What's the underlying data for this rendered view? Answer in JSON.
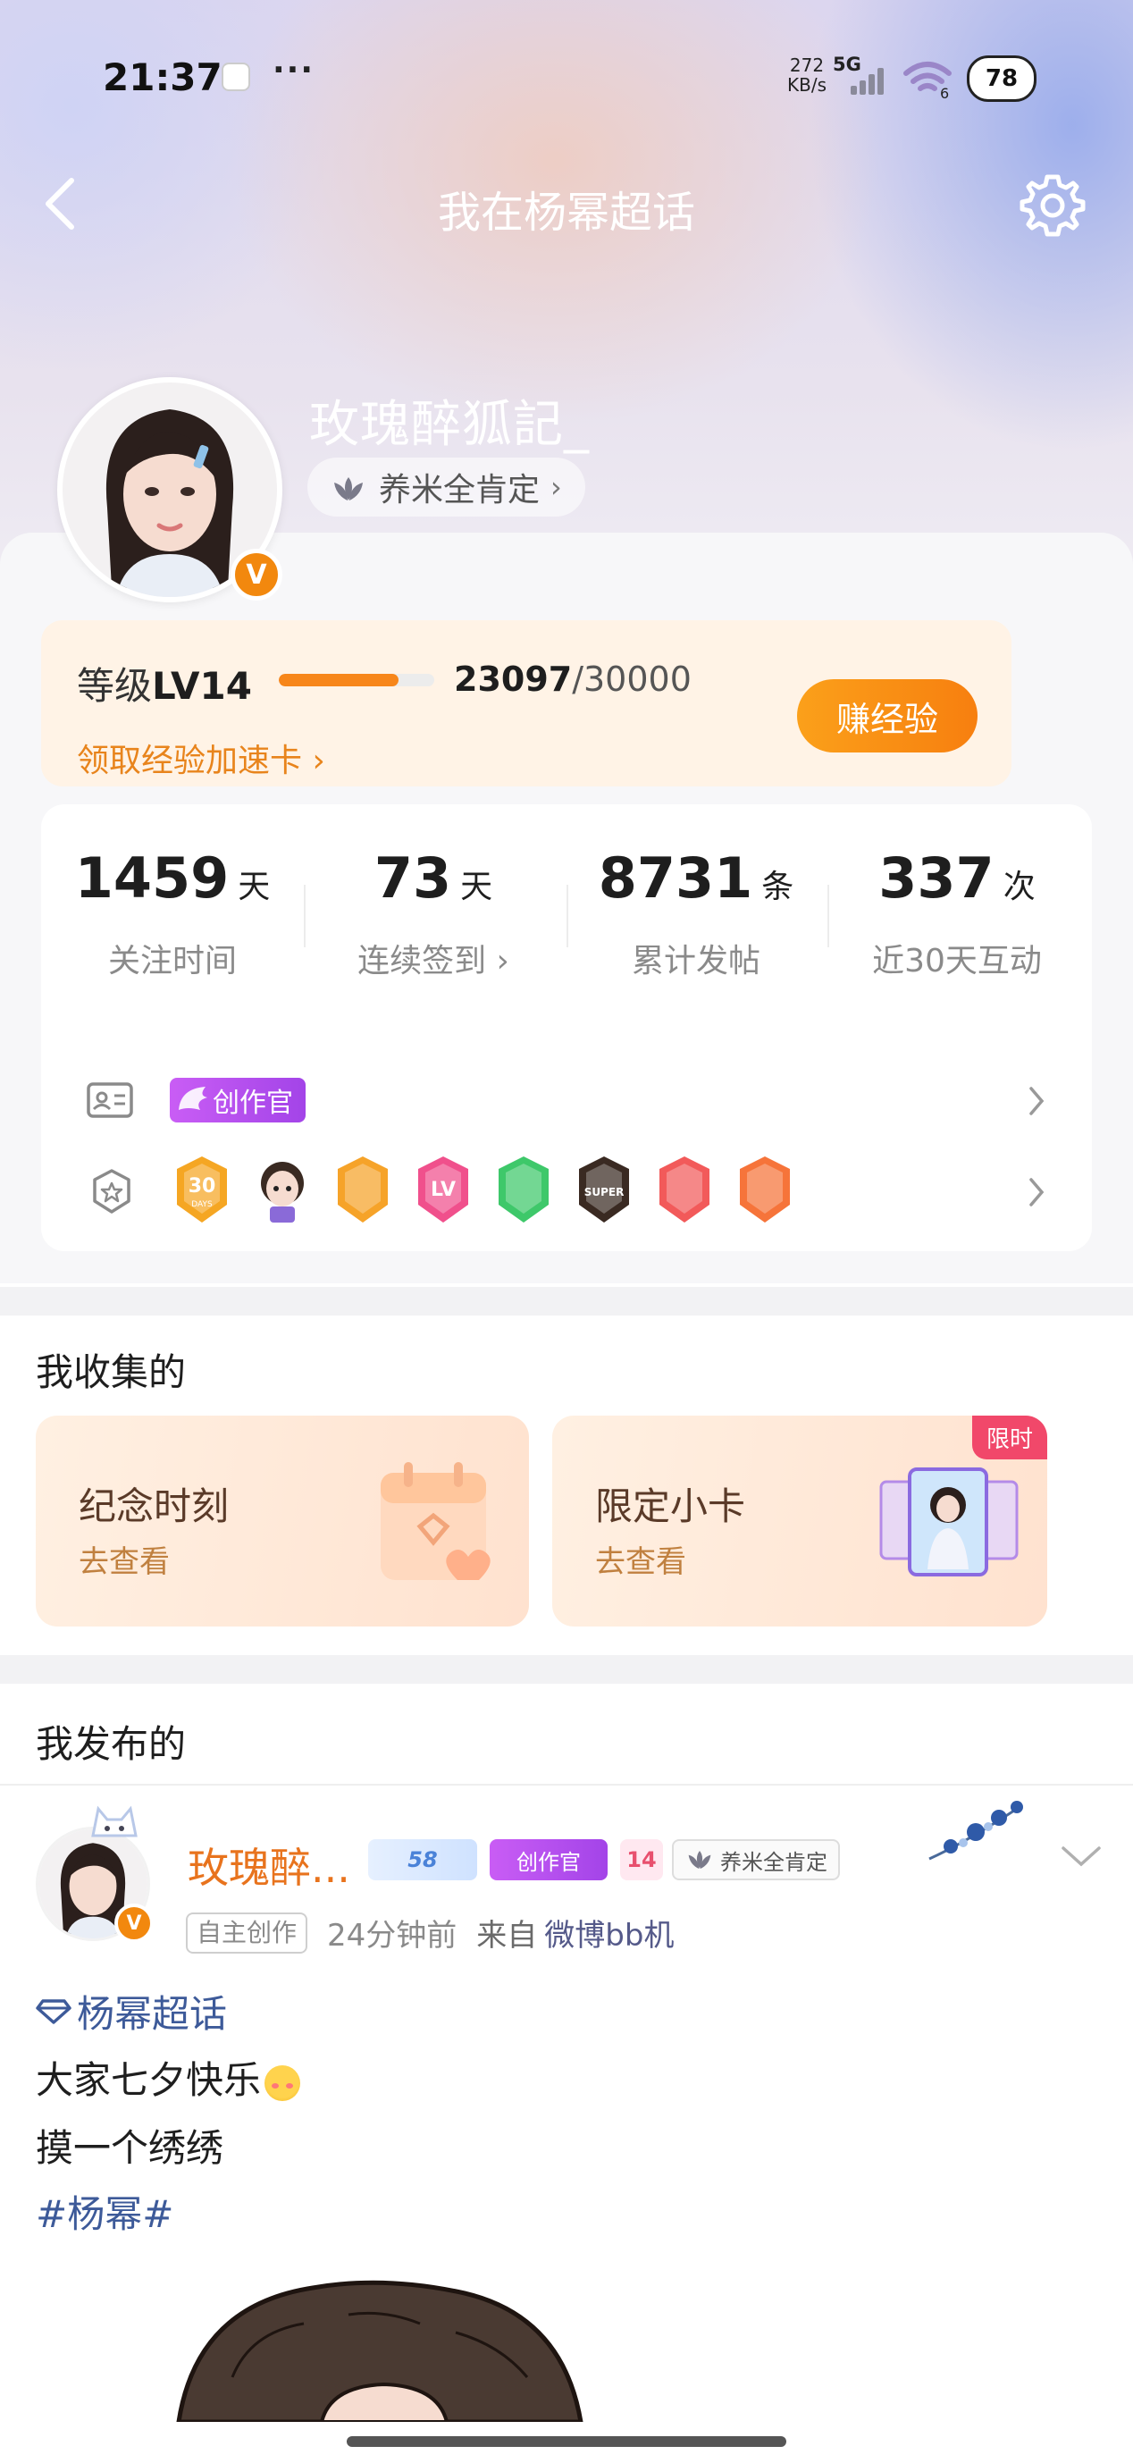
{
  "status_bar": {
    "time": "21:37",
    "more": "···",
    "net_speed_value": "272",
    "net_speed_unit": "KB/s",
    "network": "5G",
    "wifi_badge": "6",
    "battery": "78"
  },
  "nav": {
    "title": "我在杨幂超话",
    "back_icon": "back-chevron-icon",
    "settings_icon": "gear-icon"
  },
  "profile": {
    "username": "玫瑰醉狐記_",
    "verify_badge": "V",
    "honor_label": "养米全肯定",
    "honor_icon": "lotus-icon"
  },
  "level": {
    "label_prefix": "等级",
    "level": "LV14",
    "exp_current": "23097",
    "exp_total": "/30000",
    "progress_fraction": 0.77,
    "boost_link": "领取经验加速卡 ›",
    "earn_button": "赚经验"
  },
  "stats": [
    {
      "value": "1459",
      "unit": "天",
      "label": "关注时间"
    },
    {
      "value": "73",
      "unit": "天",
      "label": "连续签到 ›"
    },
    {
      "value": "8731",
      "unit": "条",
      "label": "累计发帖"
    },
    {
      "value": "337",
      "unit": "次",
      "label": "近30天互动"
    }
  ],
  "identity_row": {
    "icon": "id-card-icon",
    "badge": "创作官"
  },
  "medal_row": {
    "icon": "medal-outline-icon",
    "medals": [
      {
        "name": "30-days-medal",
        "text": "30",
        "sub": "DAYS",
        "color": "#f5a623"
      },
      {
        "name": "cartoon-boy-medal",
        "text": "",
        "sub": "",
        "color": "#3a2a22"
      },
      {
        "name": "crown-medal",
        "text": "",
        "sub": "",
        "color": "#f6a329"
      },
      {
        "name": "lv-medal",
        "text": "LV",
        "sub": "",
        "color": "#f0508c"
      },
      {
        "name": "hand-medal",
        "text": "",
        "sub": "",
        "color": "#3ec86a"
      },
      {
        "name": "super-medal",
        "text": "SUPER",
        "sub": "",
        "color": "#3a2a22"
      },
      {
        "name": "heart-medal",
        "text": "",
        "sub": "",
        "color": "#f25a5a"
      },
      {
        "name": "thumb-medal",
        "text": "",
        "sub": "",
        "color": "#f6743a"
      }
    ]
  },
  "collection": {
    "section_title": "我收集的",
    "cards": [
      {
        "title": "纪念时刻",
        "sub": "去查看",
        "tag": ""
      },
      {
        "title": "限定小卡",
        "sub": "去查看",
        "tag": "限时"
      }
    ]
  },
  "posts_section": {
    "section_title": "我发布的"
  },
  "post": {
    "author": "玫瑰醉...",
    "badge_lv": "58",
    "badge_creator": "创作官",
    "badge_fan_level": "14",
    "badge_honor": "养米全肯定",
    "tag": "自主创作",
    "time": "24分钟前",
    "source_prefix": "来自",
    "device": "微博bb机",
    "topic": "杨幂超话",
    "lines": [
      "大家七夕快乐",
      "摸一个绣绣"
    ],
    "hashtag": "#杨幂#"
  },
  "colors": {
    "accent_orange": "#f7861a",
    "link_blue": "#3d5a99",
    "creator_purple": "#b04ff0"
  }
}
